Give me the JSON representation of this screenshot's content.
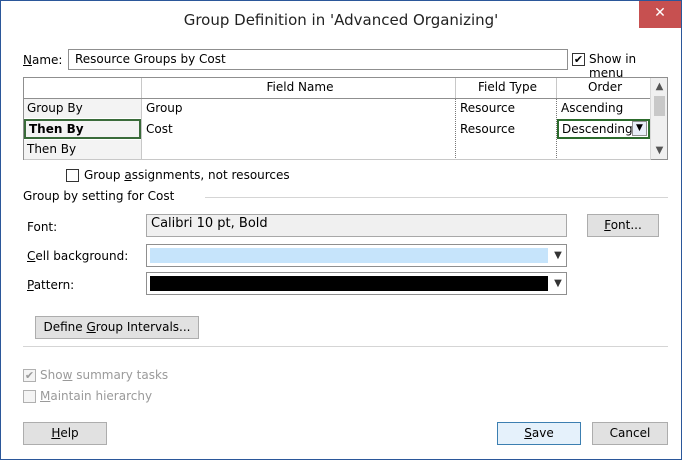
{
  "window": {
    "title": "Group Definition in 'Advanced Organizing'",
    "close_glyph": "✕"
  },
  "name": {
    "label_prefix": "",
    "label_accel": "N",
    "label_rest": "ame:",
    "value": "Resource Groups by Cost"
  },
  "show_in_menu": {
    "label_pre": "Show in ",
    "label_accel": "m",
    "label_post": "enu",
    "checked": true
  },
  "grid": {
    "headers": [
      "",
      "Field Name",
      "Field Type",
      "Order"
    ],
    "rows": [
      {
        "label": "Group By",
        "field": "Group",
        "type": "Resource",
        "order": "Ascending"
      },
      {
        "label": "Then By",
        "field": "Cost",
        "type": "Resource",
        "order": "Descending"
      },
      {
        "label": "Then By",
        "field": "",
        "type": "",
        "order": ""
      }
    ]
  },
  "group_assignments": {
    "label_pre": "Group ",
    "label_accel": "a",
    "label_post": "ssignments, not resources",
    "checked": false
  },
  "group_setting": {
    "heading": "Group by setting for Cost",
    "font_label": "Font:",
    "font_value": "Calibri 10 pt, Bold",
    "font_button_accel": "F",
    "font_button_rest": "ont...",
    "cell_bg_label_accel": "C",
    "cell_bg_label_rest": "ell background:",
    "cell_bg_color": "#c6e4fb",
    "pattern_label_accel": "P",
    "pattern_label_rest": "attern:",
    "pattern_color": "#000000",
    "define_intervals_pre": "Define ",
    "define_intervals_accel": "G",
    "define_intervals_post": "roup Intervals..."
  },
  "options": {
    "show_summary_pre": "Sho",
    "show_summary_accel": "w",
    "show_summary_post": " summary tasks",
    "show_summary_checked": true,
    "maintain_hierarchy_accel": "M",
    "maintain_hierarchy_rest": "aintain hierarchy",
    "maintain_hierarchy_checked": false
  },
  "buttons": {
    "help_accel": "H",
    "help_rest": "elp",
    "save_accel": "S",
    "save_rest": "ave",
    "cancel": "Cancel"
  },
  "colors": {
    "accent_border": "#2b579a",
    "close_button": "#c75050",
    "selection_border": "#2c6b2c"
  }
}
